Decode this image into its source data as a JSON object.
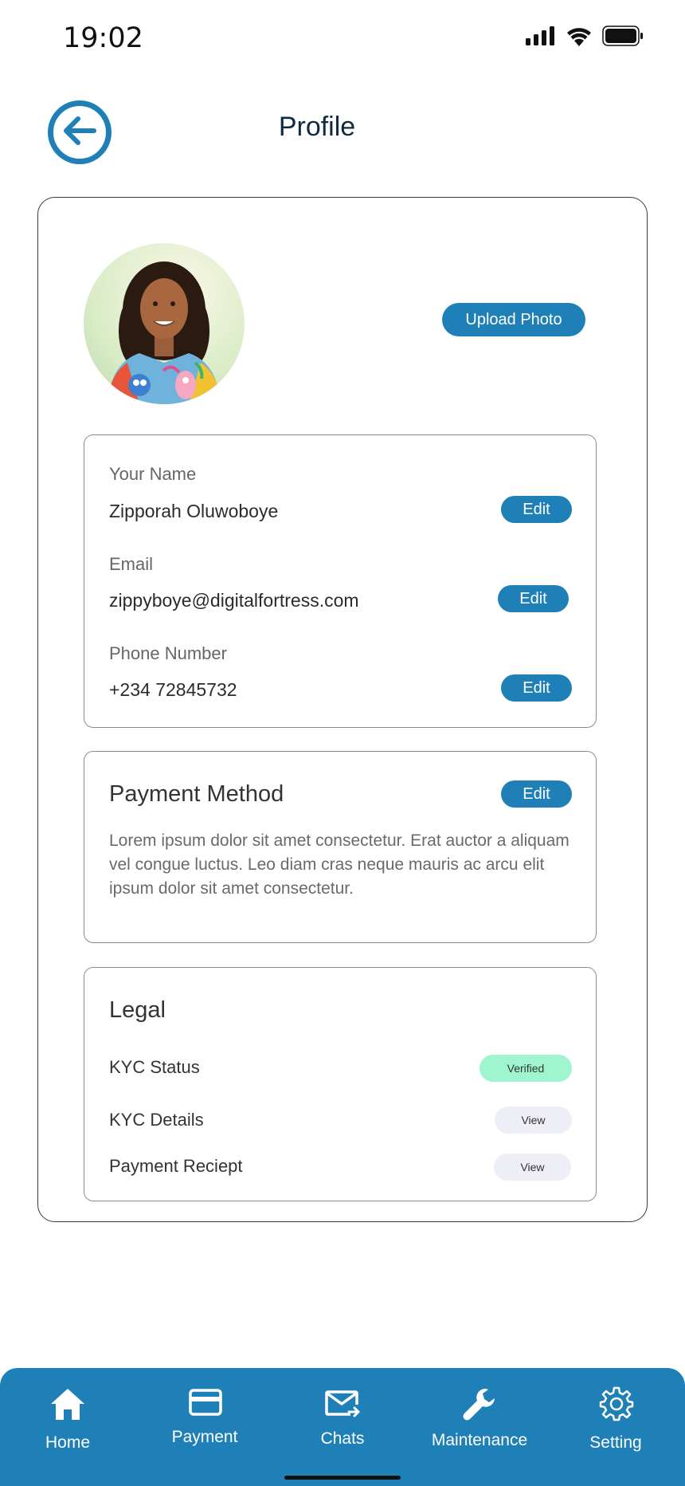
{
  "status_bar": {
    "time": "19:02",
    "icons": [
      "signal-icon",
      "wifi-icon",
      "battery-icon"
    ]
  },
  "header": {
    "title": "Profile",
    "back_icon": "arrow-left-icon"
  },
  "profile": {
    "upload_label": "Upload Photo",
    "fields": [
      {
        "label": "Your Name",
        "value": "Zipporah Oluwoboye",
        "action": "Edit"
      },
      {
        "label": "Email",
        "value": "zippyboye@digitalfortress.com",
        "action": "Edit"
      },
      {
        "label": "Phone Number",
        "value": "+234  72845732",
        "action": "Edit"
      }
    ]
  },
  "payment": {
    "heading": "Payment Method",
    "action": "Edit",
    "description": "Lorem ipsum dolor sit amet consectetur. Erat auctor a aliquam vel congue luctus. Leo diam cras neque mauris ac arcu elit ipsum dolor sit amet consectetur."
  },
  "legal": {
    "heading": "Legal",
    "rows": [
      {
        "label": "KYC Status",
        "badge": "Verified"
      },
      {
        "label": "KYC Details",
        "action": "View"
      },
      {
        "label": "Payment Reciept",
        "action": "View"
      }
    ]
  },
  "nav": {
    "items": [
      {
        "label": "Home",
        "icon": "home-icon"
      },
      {
        "label": "Payment",
        "icon": "credit-card-icon"
      },
      {
        "label": "Chats",
        "icon": "mail-icon"
      },
      {
        "label": "Maintenance",
        "icon": "wrench-icon"
      },
      {
        "label": "Setting",
        "icon": "gear-icon"
      }
    ]
  },
  "colors": {
    "accent": "#1f80b8",
    "verified_badge": "#9ef5ce",
    "view_badge": "#eeeef6",
    "title_text": "#0f2a44"
  }
}
